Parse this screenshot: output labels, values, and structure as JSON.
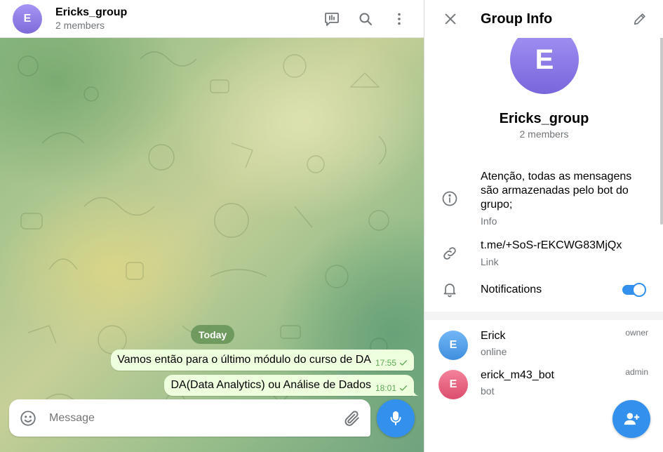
{
  "chat": {
    "avatar_letter": "E",
    "title": "Ericks_group",
    "subtitle": "2 members",
    "actions": [
      "poll-icon",
      "search-icon",
      "more-vertical-icon"
    ],
    "date_chip": "Today",
    "messages": [
      {
        "text": "Vamos então para o último módulo do curso de DA",
        "time": "17:55",
        "status": "sent-check"
      },
      {
        "text": "DA(Data Analytics) ou Análise de Dados",
        "time": "18:01",
        "status": "sent-check"
      }
    ],
    "composer": {
      "placeholder": "Message"
    }
  },
  "info_panel": {
    "title": "Group Info",
    "avatar_letter": "E",
    "name": "Ericks_group",
    "subtitle": "2 members",
    "description": "Atenção, todas as mensagens são armazenadas pelo bot do grupo;",
    "description_label": "Info",
    "link": "t.me/+SoS-rEKCWG83MjQx",
    "link_label": "Link",
    "notifications_label": "Notifications",
    "notifications_enabled": true,
    "members": [
      {
        "letter": "E",
        "name": "Erick",
        "status": "online",
        "role": "owner",
        "color": "#4a9be8"
      },
      {
        "letter": "E",
        "name": "erick_m43_bot",
        "status": "bot",
        "role": "admin",
        "color": "#e5607f"
      }
    ]
  },
  "colors": {
    "accent": "#3390ec",
    "outgoing_bubble": "#eeffde",
    "check": "#5ca853",
    "secondary_text": "#707579"
  }
}
